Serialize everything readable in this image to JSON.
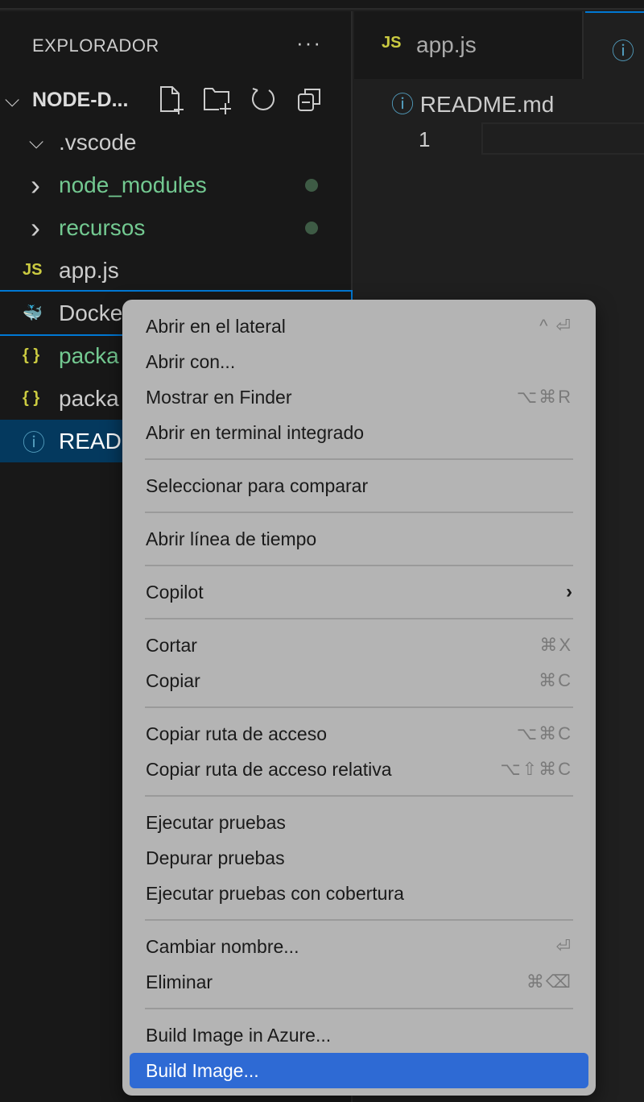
{
  "sidebar": {
    "title": "EXPLORADOR",
    "more": "···",
    "folder": "NODE-D...",
    "items": [
      {
        "label": ".vscode",
        "icon": "chevron-down",
        "color": "#cccccc"
      },
      {
        "label": "node_modules",
        "icon": "chevron-right",
        "color": "#73c991",
        "dot": true
      },
      {
        "label": "recursos",
        "icon": "chevron-right",
        "color": "#73c991",
        "dot": true
      },
      {
        "label": "app.js",
        "icon": "js",
        "color": "#cccccc"
      },
      {
        "label": "Docke",
        "icon": "docker",
        "color": "#cccccc",
        "focused": true
      },
      {
        "label": "packa",
        "icon": "json",
        "color": "#73c991"
      },
      {
        "label": "packa",
        "icon": "json",
        "color": "#cccccc"
      },
      {
        "label": "READ",
        "icon": "info",
        "color": "#ffffff",
        "selected": true
      }
    ]
  },
  "editor": {
    "tabs": [
      {
        "label": "app.js",
        "icon": "js"
      },
      {
        "label": "",
        "icon": "info",
        "active": true
      }
    ],
    "breadcrumb": "README.md",
    "line_number": "1"
  },
  "menu": {
    "groups": [
      [
        {
          "label": "Abrir en el lateral",
          "shortcut": "^ ⏎"
        },
        {
          "label": "Abrir con..."
        },
        {
          "label": "Mostrar en Finder",
          "shortcut": "⌥⌘R"
        },
        {
          "label": "Abrir en terminal integrado"
        }
      ],
      [
        {
          "label": "Seleccionar para comparar"
        }
      ],
      [
        {
          "label": "Abrir línea de tiempo"
        }
      ],
      [
        {
          "label": "Copilot",
          "submenu": true
        }
      ],
      [
        {
          "label": "Cortar",
          "shortcut": "⌘X"
        },
        {
          "label": "Copiar",
          "shortcut": "⌘C"
        }
      ],
      [
        {
          "label": "Copiar ruta de acceso",
          "shortcut": "⌥⌘C"
        },
        {
          "label": "Copiar ruta de acceso relativa",
          "shortcut": "⌥⇧⌘C"
        }
      ],
      [
        {
          "label": "Ejecutar pruebas"
        },
        {
          "label": "Depurar pruebas"
        },
        {
          "label": "Ejecutar pruebas con cobertura"
        }
      ],
      [
        {
          "label": "Cambiar nombre...",
          "shortcut": "⏎"
        },
        {
          "label": "Eliminar",
          "shortcut": "⌘⌫"
        }
      ],
      [
        {
          "label": "Build Image in Azure..."
        },
        {
          "label": "Build Image...",
          "highlighted": true
        }
      ]
    ]
  },
  "colors": {
    "accent": "#0078d4",
    "highlight": "#2e6ad4",
    "selected_row": "#04395e",
    "js": "#cbcb41",
    "info": "#519aba",
    "json": "#cbcb41"
  }
}
